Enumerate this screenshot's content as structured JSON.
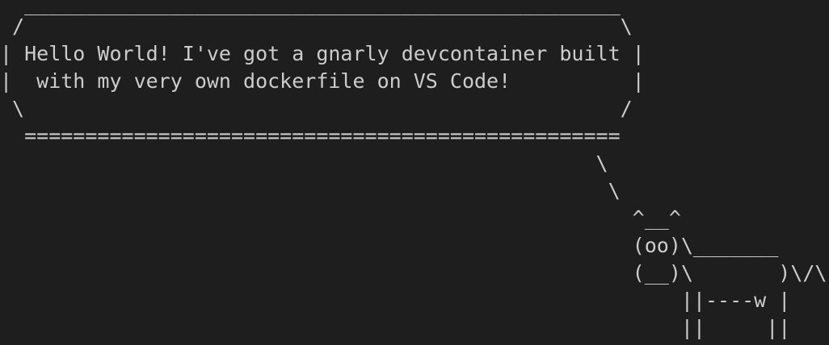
{
  "terminal": {
    "background": "#1e1e1e",
    "foreground": "#cccccc",
    "lines": [
      "  _________________________________________________",
      " /                                                 \\",
      "| Hello World! I've got a gnarly devcontainer built |",
      "|  with my very own dockerfile on VS Code!          |",
      " \\                                                 /",
      "  =================================================",
      "                                                 \\",
      "                                                  \\",
      "                                                    ^__^",
      "                                                    (oo)\\_______",
      "                                                    (__)\\       )\\/\\",
      "                                                        ||----w |",
      "                                                        ||     ||"
    ]
  }
}
